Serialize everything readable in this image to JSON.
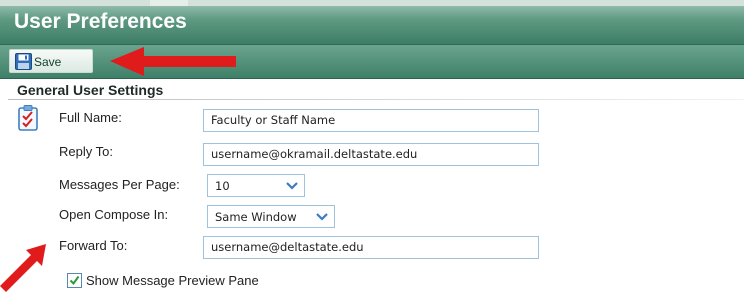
{
  "header": {
    "title": "User Preferences"
  },
  "toolbar": {
    "save_label": "Save"
  },
  "section": {
    "title": "General User Settings"
  },
  "form": {
    "full_name": {
      "label": "Full Name:",
      "value": "Faculty or Staff Name"
    },
    "reply_to": {
      "label": "Reply To:",
      "value": "username@okramail.deltastate.edu"
    },
    "messages_per_page": {
      "label": "Messages Per Page:",
      "value": "10"
    },
    "open_compose_in": {
      "label": "Open Compose In:",
      "value": "Same Window"
    },
    "forward_to": {
      "label": "Forward To:",
      "value": "username@deltastate.edu"
    },
    "show_preview": {
      "label": "Show Message Preview Pane",
      "checked": true
    }
  },
  "colors": {
    "header": "#3d7d65",
    "annotation_arrow": "#e01b1b",
    "field_border": "#9fc3dc"
  },
  "icons": [
    "save-icon",
    "settings-checklist-icon",
    "chevron-down-icon",
    "checkmark-icon",
    "annotation-arrow"
  ]
}
